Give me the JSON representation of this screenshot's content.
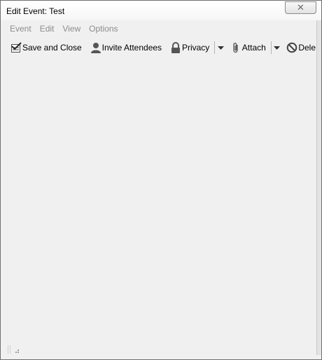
{
  "window": {
    "title": "Edit Event: Test",
    "close_glyph": "✕"
  },
  "menubar": {
    "items": [
      {
        "label": "Event"
      },
      {
        "label": "Edit"
      },
      {
        "label": "View"
      },
      {
        "label": "Options"
      }
    ]
  },
  "toolbar": {
    "save_close_label": "Save and Close",
    "invite_label": "Invite Attendees",
    "privacy_label": "Privacy",
    "attach_label": "Attach",
    "delete_label": "Dele"
  },
  "icons": {
    "save": "save-close-icon",
    "invite": "person-icon",
    "privacy": "lock-icon",
    "attach": "paperclip-icon",
    "delete": "delete-circle-icon"
  }
}
